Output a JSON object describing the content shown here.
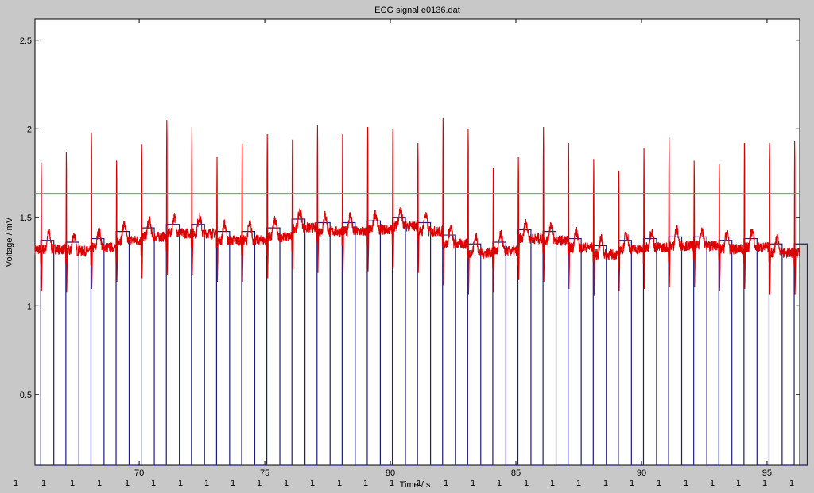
{
  "chart_data": {
    "type": "line",
    "title": "ECG signal e0136.dat",
    "xlabel": "Time / s",
    "ylabel": "Voltage / mV",
    "xlim": [
      65.85,
      96.3
    ],
    "ylim": [
      0.1,
      2.62
    ],
    "xticks": [
      70,
      75,
      80,
      85,
      90,
      95
    ],
    "yticks": [
      0.5,
      1,
      1.5,
      2,
      2.5
    ],
    "grid": false,
    "colors": {
      "signal": "#dd0000",
      "threshold": "#22cc22",
      "detector": "#1c1c80",
      "background": "#c8c8c8",
      "plot_area": "#ffffff"
    },
    "threshold": 1.635,
    "beat_label": "1",
    "beat_times": [
      66.1,
      67.1,
      68.1,
      69.1,
      70.1,
      71.1,
      72.1,
      73.1,
      74.1,
      75.1,
      76.1,
      77.1,
      78.1,
      79.1,
      80.1,
      81.1,
      82.1,
      83.1,
      84.1,
      85.1,
      86.1,
      87.1,
      88.1,
      89.1,
      90.1,
      91.1,
      92.1,
      93.1,
      94.1,
      95.1,
      96.1
    ],
    "r_peaks": [
      1.86,
      1.92,
      2.03,
      1.87,
      1.96,
      2.1,
      2.06,
      1.89,
      1.96,
      2.02,
      1.99,
      2.07,
      2.02,
      2.06,
      2.05,
      1.97,
      2.11,
      2.05,
      1.83,
      1.89,
      2.06,
      1.97,
      1.88,
      1.81,
      1.94,
      2.0,
      1.87,
      1.85,
      1.97,
      1.97,
      1.98
    ],
    "baseline_levels": [
      1.37,
      1.36,
      1.38,
      1.42,
      1.44,
      1.46,
      1.46,
      1.42,
      1.42,
      1.44,
      1.49,
      1.47,
      1.47,
      1.48,
      1.5,
      1.47,
      1.4,
      1.35,
      1.36,
      1.43,
      1.42,
      1.38,
      1.34,
      1.37,
      1.38,
      1.39,
      1.39,
      1.37,
      1.38,
      1.35,
      1.35
    ],
    "detector_low": 0.1,
    "series": [
      {
        "values_ref": "synthesized from r_peaks and baseline_levels"
      }
    ],
    "beat_markers": {
      "baseline_value": 0.1
    }
  }
}
